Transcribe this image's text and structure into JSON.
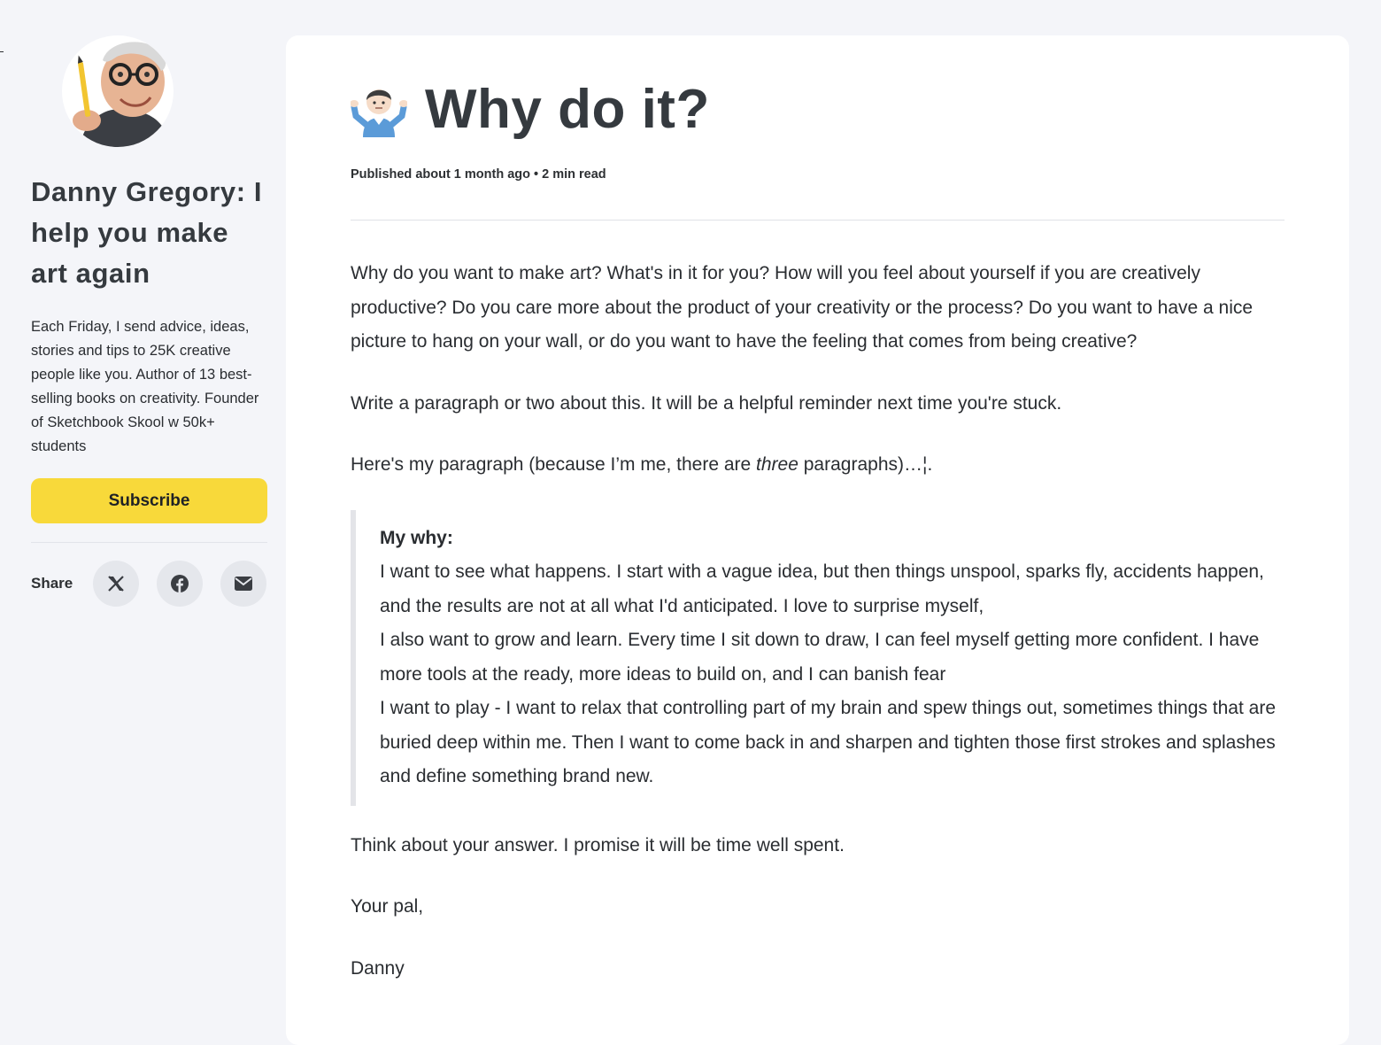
{
  "sidebar": {
    "author_name": "Danny Gregory: I help you make art again",
    "bio": "Each Friday, I send advice, ideas, stories and tips to 25K creative people like you. Author of 13 best-selling books on creativity. Founder of Sketchbook Skool w 50k+ students",
    "subscribe_label": "Subscribe",
    "share_label": "Share",
    "share_buttons": [
      {
        "icon": "x-icon"
      },
      {
        "icon": "facebook-icon"
      },
      {
        "icon": "email-icon"
      }
    ]
  },
  "post": {
    "title_emoji": "person-shrugging-emoji",
    "title": "Why do it?",
    "meta": "Published about 1 month ago • 2 min read",
    "paragraph1": "Why do you want to make art? What's in it for you? How will you feel about yourself if you are creatively productive? Do you care more about the product of your creativity or the process? Do you want to have a nice picture to hang on your wall, or do you want to have the feeling that comes from being creative?",
    "paragraph2": "Write a paragraph or two about this. It will be a helpful reminder next time you're stuck.",
    "paragraph3_before": "Here's my paragraph (because I’m me, there are ",
    "paragraph3_em": "three",
    "paragraph3_after": " paragraphs)…¦.",
    "quote_heading": "My why:",
    "quote_lines": [
      "I want to see what happens. I start with a vague idea, but then things unspool, sparks fly, accidents happen, and the results are not at all what I'd anticipated. I love to surprise myself,",
      "I also want to grow and learn. Every time I sit down to draw, I can feel myself getting more confident. I have more tools at the ready, more ideas to build on, and I can banish fear",
      "I want to play - I want to relax that controlling part of my brain and spew things out, sometimes things that are buried deep within me. Then I want to come back in and sharpen and tighten those first strokes and splashes and define something brand new."
    ],
    "paragraph4": "Think about your answer. I promise it will be time well spent.",
    "signoff": "Your pal,",
    "signature": "Danny"
  },
  "colors": {
    "page_bg": "#f4f5f9",
    "card_bg": "#ffffff",
    "subscribe_bg": "#f8d93a",
    "share_btn_bg": "#e5e7ec",
    "quote_border": "#e3e4e8",
    "text": "#2a2d31"
  }
}
